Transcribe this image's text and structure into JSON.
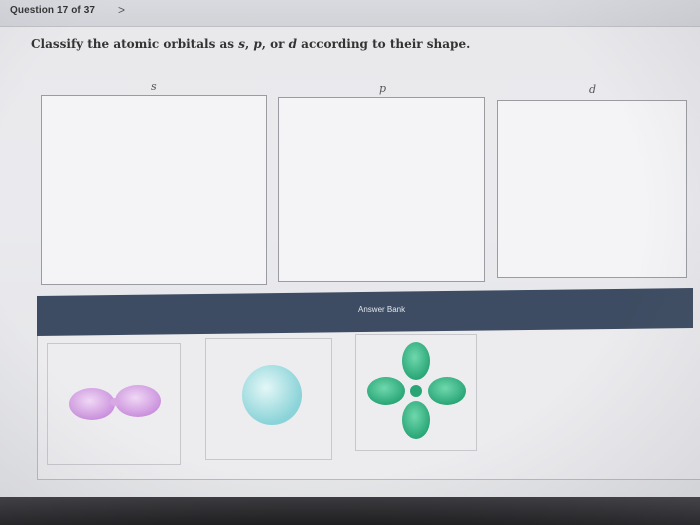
{
  "header": {
    "question_counter": "Question 17 of 37",
    "next_glyph": ">"
  },
  "prompt": {
    "part1": "Classify the atomic orbitals as ",
    "s": "s",
    "sep1": ", ",
    "p": "p",
    "sep2": ", or ",
    "d": "d",
    "part2": " according to their shape."
  },
  "categories": [
    {
      "label": "s"
    },
    {
      "label": "p"
    },
    {
      "label": "d"
    }
  ],
  "answer_bank": {
    "title": "Answer Bank",
    "items": [
      {
        "icon": "p-orbital-icon",
        "color": "#d7a8e4"
      },
      {
        "icon": "s-orbital-icon",
        "color": "#a9e2e4"
      },
      {
        "icon": "d-orbital-icon",
        "color": "#34b384"
      }
    ]
  },
  "colors": {
    "bank_header": "#3d4c62"
  }
}
